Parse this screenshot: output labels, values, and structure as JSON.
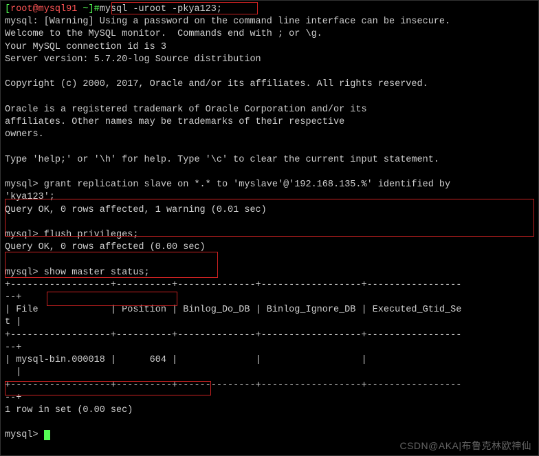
{
  "prompt": {
    "open": "[",
    "user_host": "root@mysql91",
    "sep": " ~",
    "close": "]#",
    "command": "mysql -uroot -pkya123;"
  },
  "startup": {
    "line1": "mysql: [Warning] Using a password on the command line interface can be insecure.",
    "line2": "Welcome to the MySQL monitor.  Commands end with ; or \\g.",
    "line3": "Your MySQL connection id is 3",
    "line4": "Server version: 5.7.20-log Source distribution",
    "copyright": "Copyright (c) 2000, 2017, Oracle and/or its affiliates. All rights reserved.",
    "trademark1": "Oracle is a registered trademark of Oracle Corporation and/or its",
    "trademark2": "affiliates. Other names may be trademarks of their respective",
    "trademark3": "owners.",
    "help": "Type 'help;' or '\\h' for help. Type '\\c' to clear the current input statement."
  },
  "sql1": {
    "prompt": "mysql> ",
    "line1": "grant replication slave on *.* to 'myslave'@'192.168.135.%' identified by ",
    "line2": "'kya123';",
    "result": "Query OK, 0 rows affected, 1 warning (0.01 sec)"
  },
  "sql2": {
    "prompt": "mysql> ",
    "command": "flush privileges;",
    "result": "Query OK, 0 rows affected (0.00 sec)"
  },
  "sql3": {
    "prompt": "mysql> ",
    "command": "show master status;",
    "border": "+------------------+----------+--------------+------------------+-----------------",
    "border_cont": "--+",
    "header": "| File             | Position | Binlog_Do_DB | Binlog_Ignore_DB | Executed_Gtid_Se",
    "header_cont": "t |",
    "row": "| mysql-bin.000018 |      604 |              |                  |                 ",
    "row_cont": "  |",
    "footer": "1 row in set (0.00 sec)"
  },
  "final_prompt": {
    "prompt": "mysql> "
  },
  "watermark": "CSDN@AKA|布鲁克林欧神仙",
  "chart_data": {
    "type": "table",
    "title": "show master status",
    "columns": [
      "File",
      "Position",
      "Binlog_Do_DB",
      "Binlog_Ignore_DB",
      "Executed_Gtid_Set"
    ],
    "rows": [
      {
        "File": "mysql-bin.000018",
        "Position": 604,
        "Binlog_Do_DB": "",
        "Binlog_Ignore_DB": "",
        "Executed_Gtid_Set": ""
      }
    ]
  }
}
